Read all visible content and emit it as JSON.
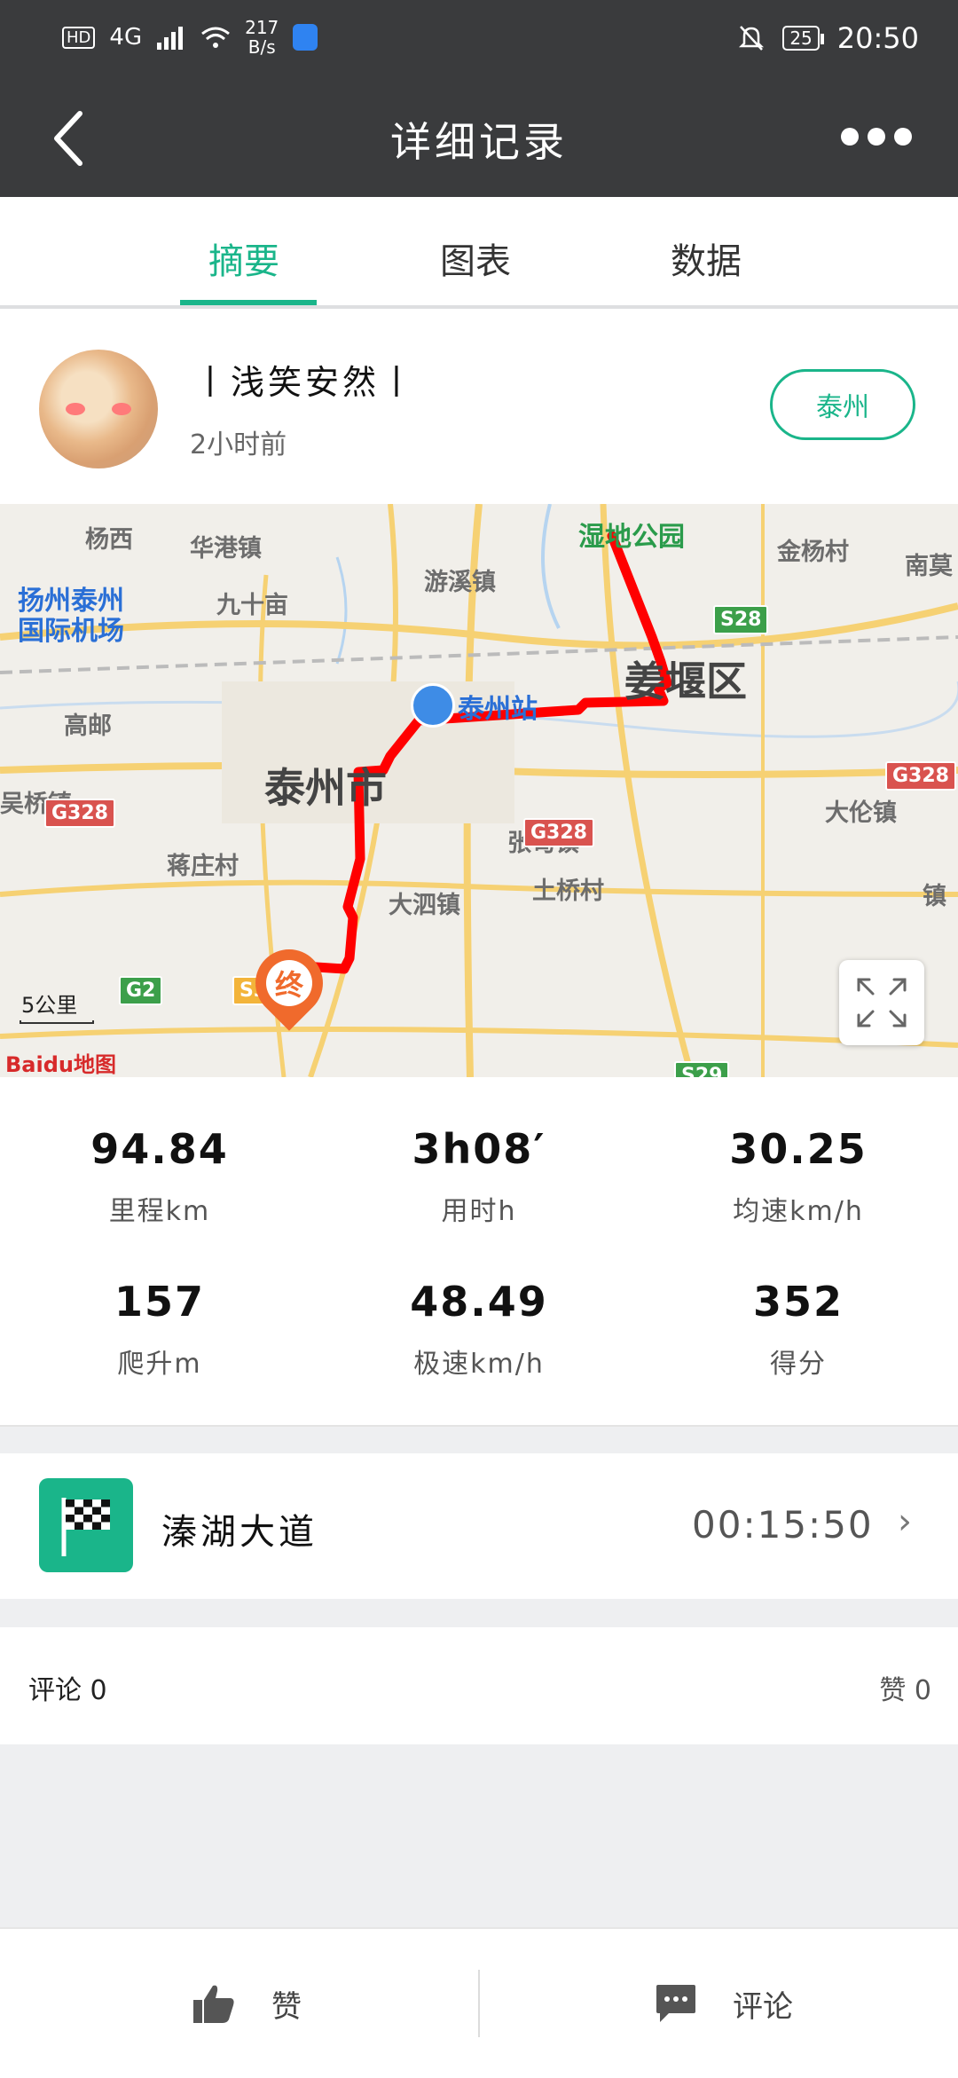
{
  "status_bar": {
    "network_type": "4G",
    "hd": "HD",
    "speed_value": "217",
    "speed_unit": "B/s",
    "battery": "25",
    "time": "20:50"
  },
  "header": {
    "title": "详细记录"
  },
  "tabs": [
    {
      "label": "摘要",
      "active": true
    },
    {
      "label": "图表",
      "active": false
    },
    {
      "label": "数据",
      "active": false
    }
  ],
  "user": {
    "name": "丨浅笑安然丨",
    "time_ago": "2小时前",
    "city_button": "泰州"
  },
  "map": {
    "labels": {
      "yangxi": "杨西",
      "huagang": "华港镇",
      "airport1": "扬州泰州",
      "airport2": "国际机场",
      "jiushiwei": "九十亩",
      "youxi": "游溪镇",
      "taizhou_station": "泰州站",
      "gaoyou": "高邮",
      "taizhou_city": "泰州市",
      "wuqiao": "吴桥镇",
      "jiangyan": "姜堰区",
      "jinyang": "金杨村",
      "nanmo": "南莫",
      "shidi1": "湿地公园",
      "zhangdian": "张甸镇",
      "dalun": "大伦镇",
      "jiangzhuang": "蒋庄村",
      "dasi": "大泗镇",
      "tuqiao": "土桥村",
      "zhen": "镇"
    },
    "road_signs": [
      "G328",
      "G328",
      "G328",
      "G328",
      "S28",
      "G2",
      "S35",
      "S29"
    ],
    "end_marker": "终",
    "scale": "5公里",
    "logo": "Baidu地图",
    "route_color": "#ff0000"
  },
  "stats": [
    {
      "value": "94.84",
      "label": "里程km"
    },
    {
      "value": "3h08′",
      "label": "用时h"
    },
    {
      "value": "30.25",
      "label": "均速km/h"
    },
    {
      "value": "157",
      "label": "爬升m"
    },
    {
      "value": "48.49",
      "label": "极速km/h"
    },
    {
      "value": "352",
      "label": "得分"
    }
  ],
  "segment": {
    "name": "溱湖大道",
    "time": "00:15:50",
    "icon": "checkered-flag-icon"
  },
  "comments": {
    "comments_label": "评论",
    "comments_count": "0",
    "likes_label": "赞",
    "likes_count": "0"
  },
  "bottom_bar": {
    "like_label": "赞",
    "comment_label": "评论"
  },
  "colors": {
    "accent": "#1ab58a",
    "header_bg": "#3a3b3d"
  }
}
